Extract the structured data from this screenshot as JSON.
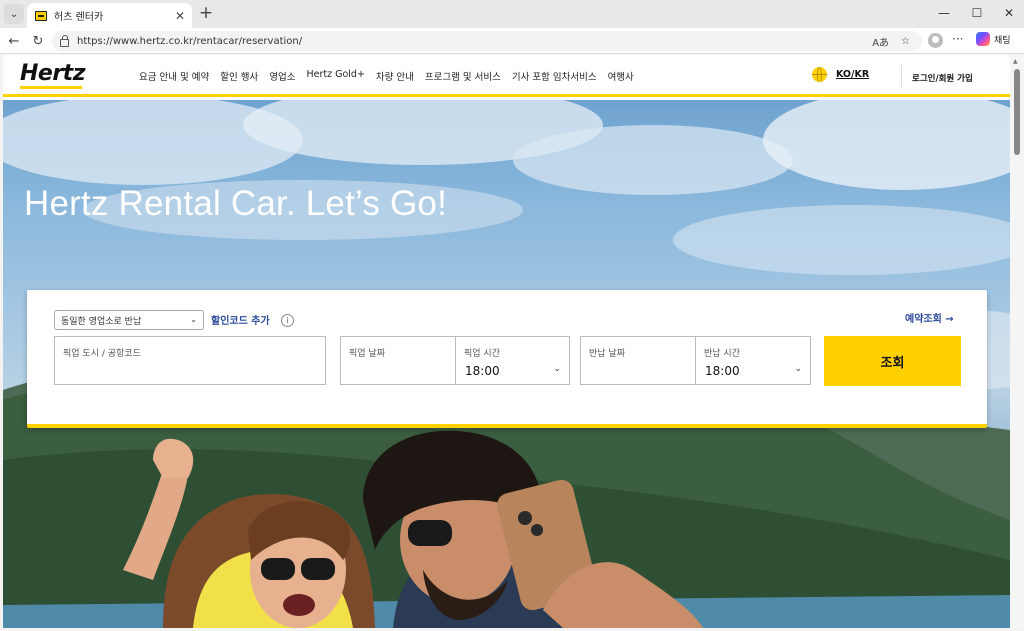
{
  "browser": {
    "tab_title": "허츠 렌터카",
    "url": "https://www.hertz.co.kr/rentacar/reservation/",
    "copilot_label": "채팅"
  },
  "header": {
    "logo": "Hertz",
    "nav": [
      "요금 안내 및 예약",
      "할인 행사",
      "영업소",
      "Hertz Gold+",
      "차량 안내",
      "프로그램 및 서비스",
      "기사 포함 임차서비스",
      "여행사"
    ],
    "language": "KO/KR",
    "login": "로그인/회원 가입"
  },
  "hero": {
    "headline": "Hertz Rental Car. Let’s Go!"
  },
  "booking": {
    "return_option": "동일한 영업소로 반납",
    "promo_link": "할인코드 추가",
    "info_icon": "i",
    "lookup_link": "예약조회 →",
    "pickup_location_label": "픽업 도시 / 공항코드",
    "pickup_date_label": "픽업 날짜",
    "pickup_time_label": "픽업 시간",
    "pickup_time_value": "18:00",
    "return_date_label": "반납 날짜",
    "return_time_label": "반납 시간",
    "return_time_value": "18:00",
    "search_button": "조회"
  },
  "colors": {
    "brand_yellow": "#ffd100",
    "link_blue": "#2b4a9b"
  },
  "icons": [
    "tab-list-icon",
    "close-icon",
    "plus-icon",
    "minimize-icon",
    "maximize-icon",
    "window-close-icon",
    "back-arrow-icon",
    "reload-icon",
    "lock-icon",
    "read-aloud-icon",
    "favorite-star-icon",
    "profile-icon",
    "more-icon",
    "copilot-icon",
    "globe-icon",
    "info-icon",
    "chevron-down-icon"
  ]
}
